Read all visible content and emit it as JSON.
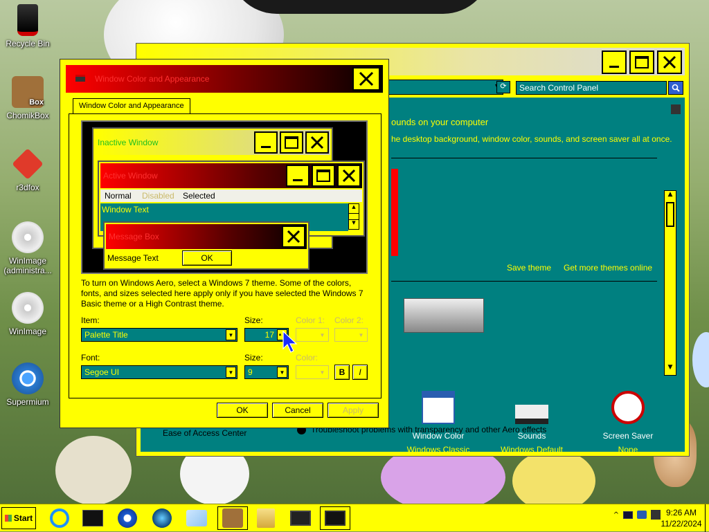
{
  "desktop": {
    "icons": [
      {
        "label": "Recycle Bin",
        "icon": "recycle-bin-icon"
      },
      {
        "label": "ChomikBox",
        "icon": "chomikbox-icon",
        "badge": "Box"
      },
      {
        "label": "r3dfox",
        "icon": "r3dfox-icon"
      },
      {
        "label": "WinImage (administra...",
        "icon": "winimage-icon"
      },
      {
        "label": "WinImage",
        "icon": "winimage-icon"
      },
      {
        "label": "Supermium",
        "icon": "supermium-icon"
      }
    ]
  },
  "control_panel": {
    "address": "ation",
    "search_placeholder": "Search Control Panel",
    "heading": "ounds on your computer",
    "description": "he desktop background, window color, sounds, and screen saver all at once.",
    "save_theme": "Save theme",
    "get_more_themes": "Get more themes online",
    "items": [
      {
        "label": "Window Color",
        "sub": "Windows Classic",
        "icon": "window-color-icon"
      },
      {
        "label": "Sounds",
        "sub": "Windows Default",
        "icon": "sounds-icon"
      },
      {
        "label": "Screen Saver",
        "sub": "None",
        "icon": "screen-saver-icon"
      }
    ],
    "ease_of_access": "Ease of Access Center",
    "troubleshoot": "Troubleshoot problems with transparency and other Aero effects"
  },
  "dialog": {
    "title": "Window Color and Appearance",
    "tab": "Window Color and Appearance",
    "preview": {
      "inactive_title": "Inactive Window",
      "active_title": "Active Window",
      "menu_normal": "Normal",
      "menu_disabled": "Disabled",
      "menu_selected": "Selected",
      "window_text": "Window Text",
      "message_box_title": "Message Box",
      "message_text": "Message Text",
      "ok": "OK"
    },
    "info": "To turn on Windows Aero, select a Windows 7 theme.  Some of the colors, fonts, and sizes selected here apply only if you have selected the Windows 7 Basic theme or a High Contrast theme.",
    "item_label": "Item:",
    "item_value": "Palette Title",
    "size_label": "Size:",
    "size_value": "17",
    "color1_label": "Color 1:",
    "color2_label": "Color 2:",
    "font_label": "Font:",
    "font_value": "Segoe UI",
    "font_size_label": "Size:",
    "font_size_value": "9",
    "font_color_label": "Color:",
    "bold": "B",
    "italic": "I",
    "ok": "OK",
    "cancel": "Cancel",
    "apply": "Apply"
  },
  "taskbar": {
    "start": "Start",
    "clock_time": "9:26 AM",
    "clock_date": "11/22/2024",
    "pinned": [
      "internet-explorer-icon",
      "terminal-icon",
      "media-player-icon",
      "browser-icon",
      "explorer-icon",
      "chomikbox-icon",
      "file-manager-icon",
      "display-icon",
      "control-panel-icon"
    ]
  },
  "colors": {
    "highlight_yellow": "#ffff00",
    "teal": "#008080",
    "active_title_red": "#ff0000",
    "inactive_title": "#c8c8a0"
  }
}
